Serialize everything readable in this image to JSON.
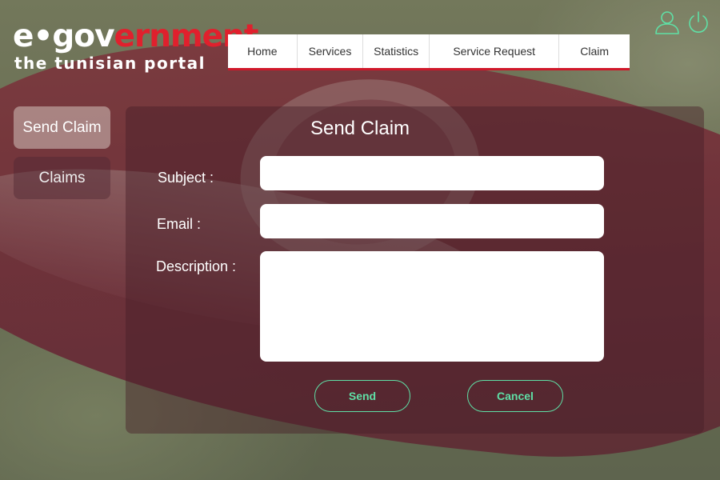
{
  "logo": {
    "main_white": "e•gov",
    "main_red": "ernment",
    "subtitle": "the tunisian portal"
  },
  "nav": {
    "items": [
      {
        "label": "Home"
      },
      {
        "label": "Services"
      },
      {
        "label": "Statistics"
      },
      {
        "label": "Service Request"
      },
      {
        "label": "Claim"
      }
    ]
  },
  "header_icons": [
    "user-icon",
    "power-icon"
  ],
  "sidebar": {
    "items": [
      {
        "label": "Send Claim",
        "active": true
      },
      {
        "label": "Claims",
        "active": false
      }
    ]
  },
  "form": {
    "title": "Send Claim",
    "subject_label": "Subject :",
    "subject_value": "",
    "email_label": "Email :",
    "email_value": "",
    "description_label": "Description :",
    "description_value": "",
    "send_label": "Send",
    "cancel_label": "Cancel"
  },
  "colors": {
    "accent": "#5fe0a6",
    "brand_red": "#e0202d",
    "nav_underline": "#d0182a"
  }
}
